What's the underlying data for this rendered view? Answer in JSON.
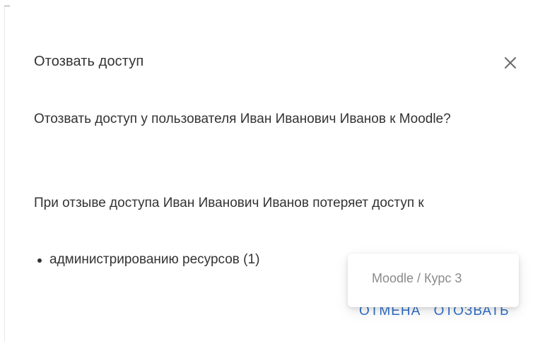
{
  "dialog": {
    "title": "Отозвать доступ",
    "close_icon": "close-icon",
    "question": "Отозвать доступ у пользователя Иван Иванович Иванов к Moodle?",
    "warning": "При отзыве доступа Иван Иванович Иванов потеряет доступ к",
    "items": [
      {
        "label": "администрированию ресурсов (1)"
      }
    ],
    "actions": {
      "cancel_label": "ОТМЕНА",
      "revoke_label": "ОТОЗВАТЬ"
    },
    "accent_color": "#2e6fc9"
  },
  "tooltip": {
    "text": "Moodle / Курс 3"
  }
}
